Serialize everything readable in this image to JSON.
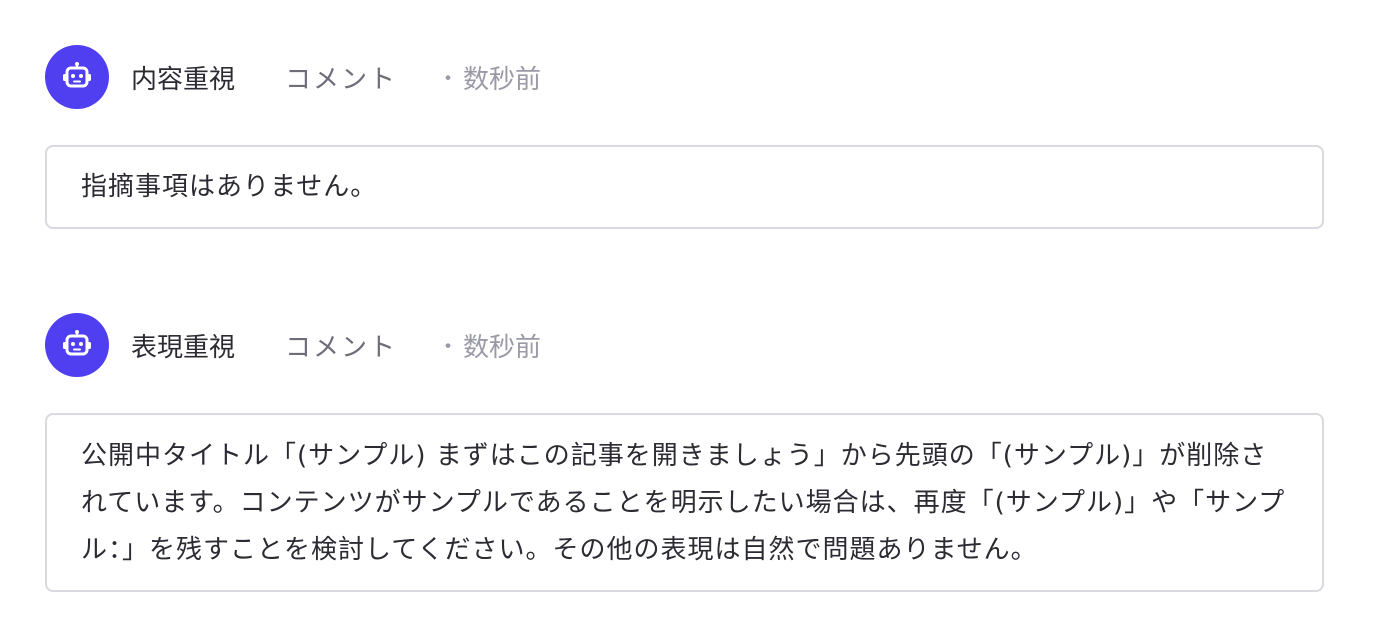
{
  "colors": {
    "avatar_bg": "#4f3ff0",
    "border": "#d9d9df",
    "text": "#2b2b33",
    "muted": "#9a9aa6"
  },
  "comments": [
    {
      "avatar_icon": "robot-icon",
      "author": "内容重視",
      "type": "コメント",
      "dot": "・",
      "time": "数秒前",
      "body": "指摘事項はありません。"
    },
    {
      "avatar_icon": "robot-icon",
      "author": "表現重視",
      "type": "コメント",
      "dot": "・",
      "time": "数秒前",
      "body": "公開中タイトル「(サンプル) まずはこの記事を開きましょう」から先頭の「(サンプル)」が削除されています。コンテンツがサンプルであることを明示したい場合は、再度「(サンプル)」や「サンプル：」を残すことを検討してください。その他の表現は自然で問題ありません。"
    }
  ]
}
